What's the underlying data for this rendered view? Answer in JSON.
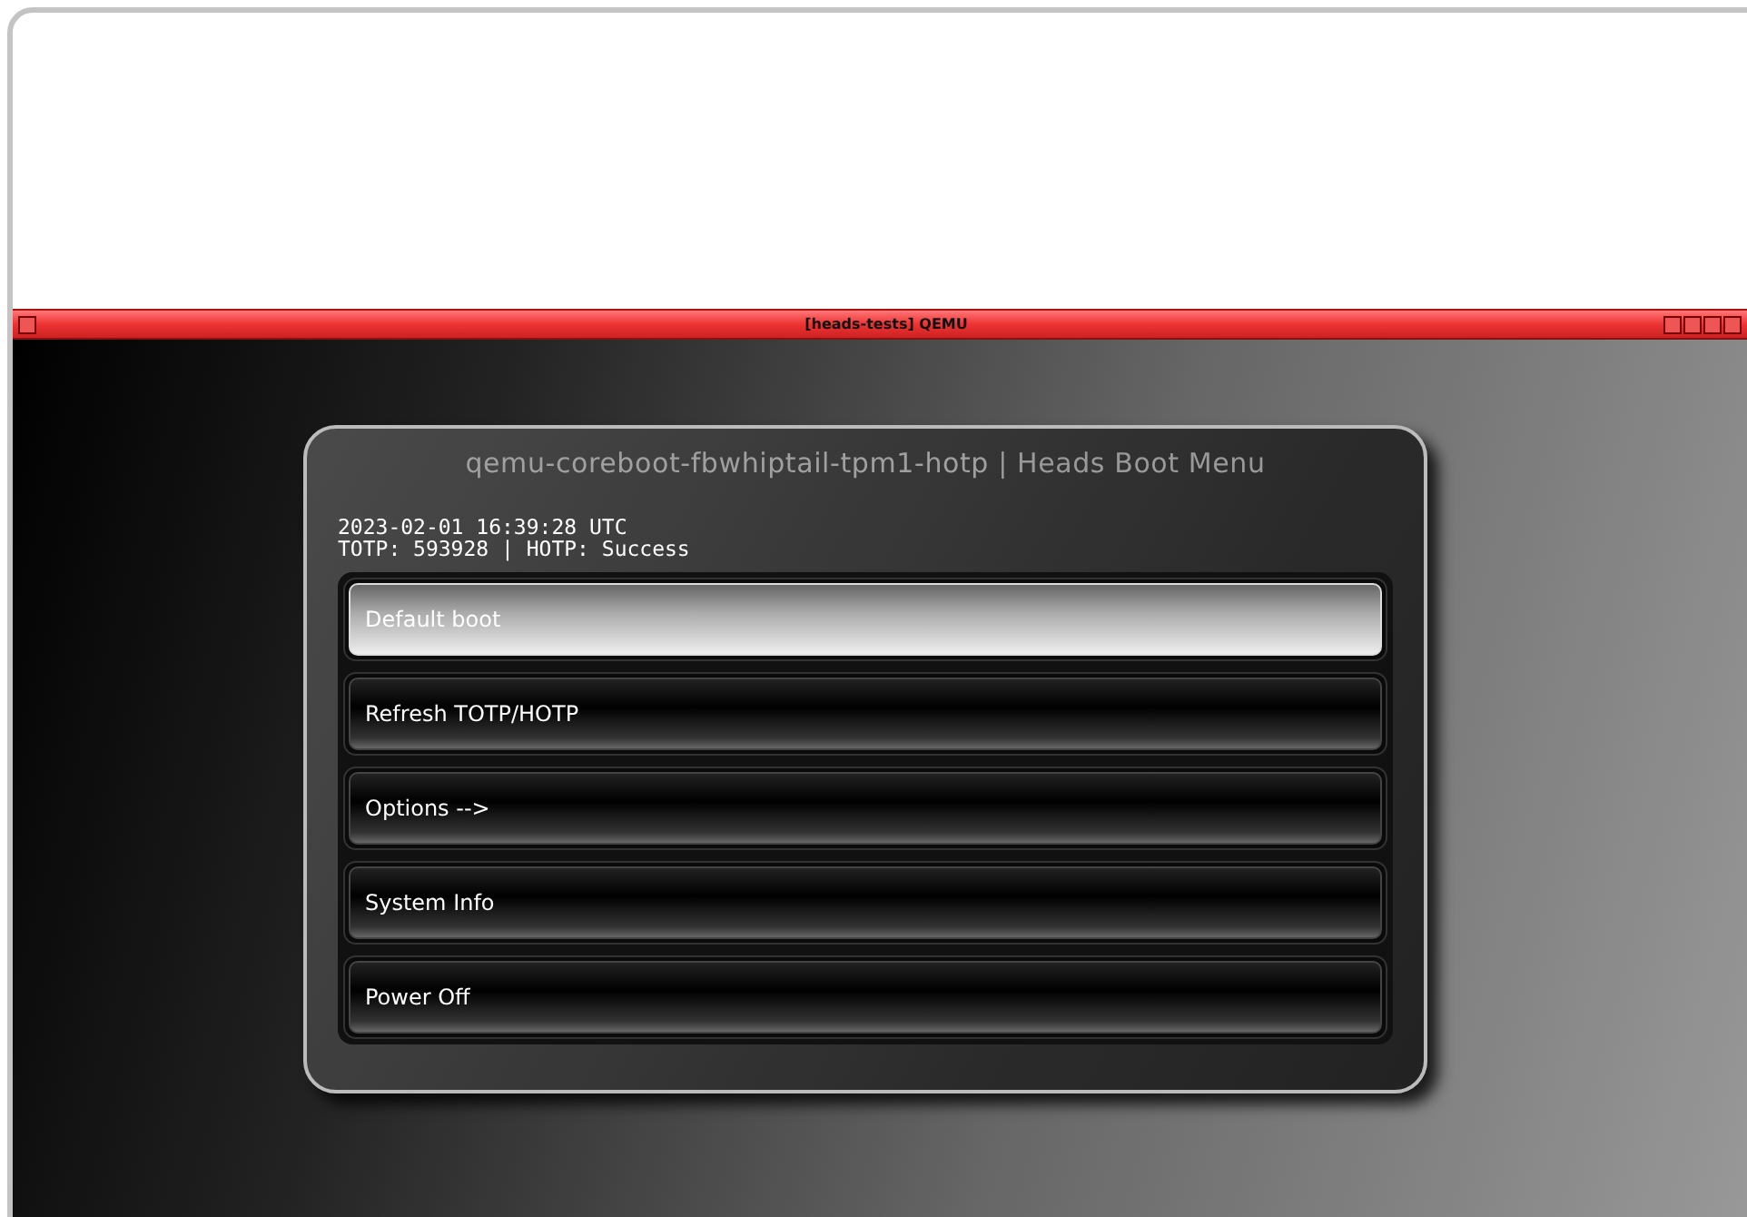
{
  "window": {
    "title": "[heads-tests] QEMU"
  },
  "dialog": {
    "title_dim": "qemu-coreboot-fbwhiptail-tpm1-hotp",
    "title": "| Heads Boot Menu",
    "info": [
      "2023-02-01 16:39:28 UTC",
      "TOTP: 593928 | HOTP: Success"
    ],
    "items": [
      {
        "label": "Default boot",
        "selected": true
      },
      {
        "label": "Refresh TOTP/HOTP",
        "selected": false
      },
      {
        "label": "Options -->",
        "selected": false
      },
      {
        "label": "System Info",
        "selected": false
      },
      {
        "label": "Power Off",
        "selected": false
      }
    ]
  }
}
